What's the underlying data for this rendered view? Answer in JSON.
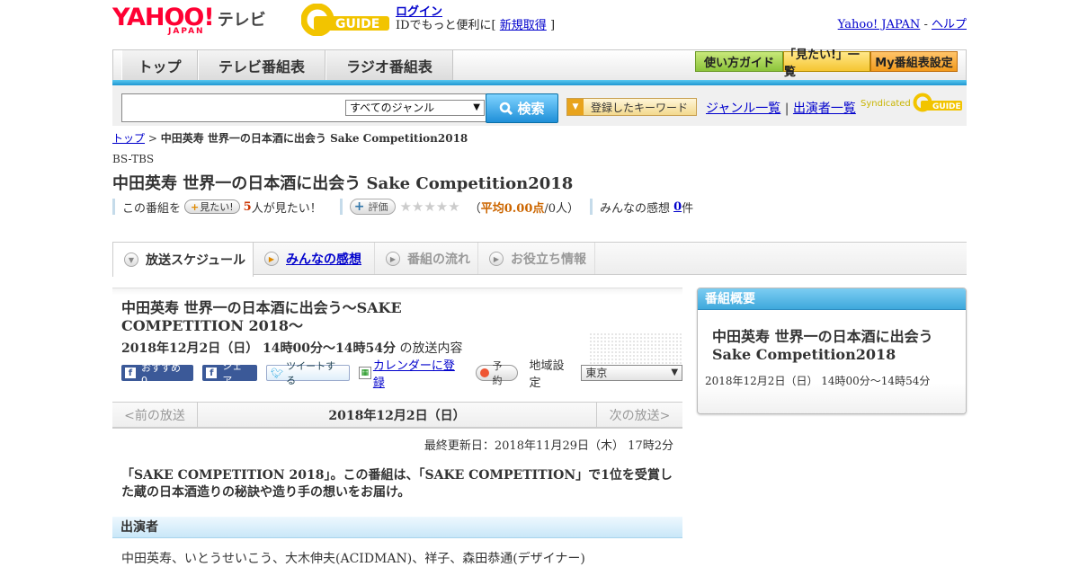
{
  "header": {
    "logo_text": "YAHOO!",
    "logo_sub": "JAPAN",
    "tv_label": "テレビ",
    "gguide_text": "GUIDE",
    "login_link": "ログイン",
    "login_prompt": "IDでもっと便利に[",
    "register_link": "新規取得",
    "login_suffix": "]",
    "yahoo_link": "Yahoo! JAPAN",
    "links_sep": "-",
    "help_link": "ヘルプ"
  },
  "nav": {
    "tabs": [
      {
        "label": "トップ"
      },
      {
        "label": "テレビ番組表"
      },
      {
        "label": "ラジオ番組表"
      }
    ],
    "guide_button": "使い方ガイド",
    "want_list_button": "「見たい!」一覧",
    "my_schedule_button": "My番組表設定"
  },
  "search": {
    "query": "",
    "genre_selected": "すべてのジャンル",
    "search_button": "検索",
    "keyword_button": "登録したキーワード",
    "genre_list_link": "ジャンル一覧",
    "links_sep": "|",
    "cast_list_link": "出演者一覧",
    "syndicated_label": "Syndicated",
    "syndicated_logo": "GUIDE"
  },
  "breadcrumb": {
    "top_link": "トップ",
    "sep": ">",
    "current": "中田英寿 世界一の日本酒に出会う Sake Competition2018"
  },
  "program": {
    "station": "BS-TBS",
    "title": "中田英寿 世界一の日本酒に出会う Sake Competition2018",
    "want_prefix": "この番組を",
    "want_button": "見たい!",
    "want_count": "5",
    "want_suffix": "人が見たい！",
    "rate_button": "評価",
    "stars": "★★★★★",
    "rating_open": "（",
    "rating_avg": "平均0.00点",
    "rating_people": "/0人）",
    "impressions_label": "みんなの感想",
    "impressions_count": "0",
    "impressions_unit": "件"
  },
  "subtabs": [
    {
      "label": "放送スケジュール"
    },
    {
      "label": "みんなの感想"
    },
    {
      "label": "番組の流れ"
    },
    {
      "label": "お役立ち情報"
    }
  ],
  "main": {
    "title": "中田英寿 世界一の日本酒に出会う～SAKE COMPETITION 2018～",
    "datetime": "2018年12月2日（日） 14時00分～14時54分",
    "datetime_suffix": "の放送内容",
    "fb_recommend": "おすすめ 0",
    "fb_share": "シェア",
    "tweet": "ツイートする",
    "calendar_link": "カレンダーに登録",
    "reserve_button": "予約",
    "region_label": "地域設定",
    "region_selected": "東京",
    "prev_broadcast": "<前の放送",
    "current_date": "2018年12月2日（日）",
    "next_broadcast": "次の放送>",
    "last_updated": "最終更新日：2018年11月29日（木） 17時2分",
    "description": "「SAKE COMPETITION 2018」。この番組は、「SAKE COMPETITION」で1位を受賞した蔵の日本酒造りの秘訣や造り手の想いをお届け。",
    "cast_heading": "出演者",
    "cast": "中田英寿、いとうせいこう、大木伸夫(ACIDMAN)、祥子、森田恭通(デザイナー)"
  },
  "side": {
    "heading": "番組概要",
    "title": "中田英寿 世界一の日本酒に出会う Sake Competition2018",
    "datetime": "2018年12月2日（日） 14時00分～14時54分"
  },
  "colors": {
    "yahoo_red": "#ff0033",
    "link_blue": "#0000cc",
    "accent_blue": "#1e96d2",
    "rating_orange": "#cc6600"
  }
}
